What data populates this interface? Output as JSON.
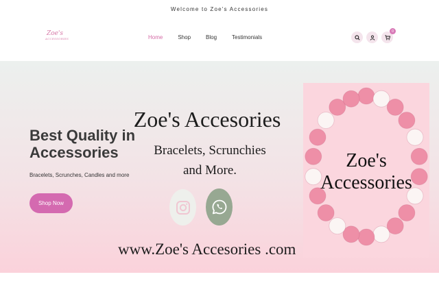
{
  "topbar": {
    "welcome": "Welcome to Zoe's Accessories"
  },
  "header": {
    "logo_text": "Zoe's",
    "logo_tagline": "ACCESSORIES",
    "nav": [
      "Home",
      "Shop",
      "Blog",
      "Testimonials"
    ],
    "active_nav": "Home",
    "icons": [
      "search-icon",
      "user-icon",
      "cart-icon"
    ],
    "cart_count": "0"
  },
  "hero": {
    "title": "Best Quality in Accessories",
    "subtitle": "Bracelets, Scrunches, Candles and more",
    "button": "Shop Now"
  },
  "banner": {
    "brand": "Zoe's Accesories",
    "tagline_line1": "Bracelets, Scrunchies",
    "tagline_line2": "and More.",
    "social": [
      "instagram-icon",
      "whatsapp-icon"
    ],
    "website": "www.Zoe's Accesories .com"
  },
  "promo": {
    "line1": "Zoe's",
    "line2": "Accessories"
  },
  "colors": {
    "accent": "#d46ab0",
    "nav_active": "#d46aa5",
    "hero_top": "#ecf0ee",
    "hero_bottom": "#fbd2db",
    "bead_pink": "#ee8fa7",
    "bead_white": "#fbf5f4",
    "whatsapp_bg": "#97a892"
  }
}
